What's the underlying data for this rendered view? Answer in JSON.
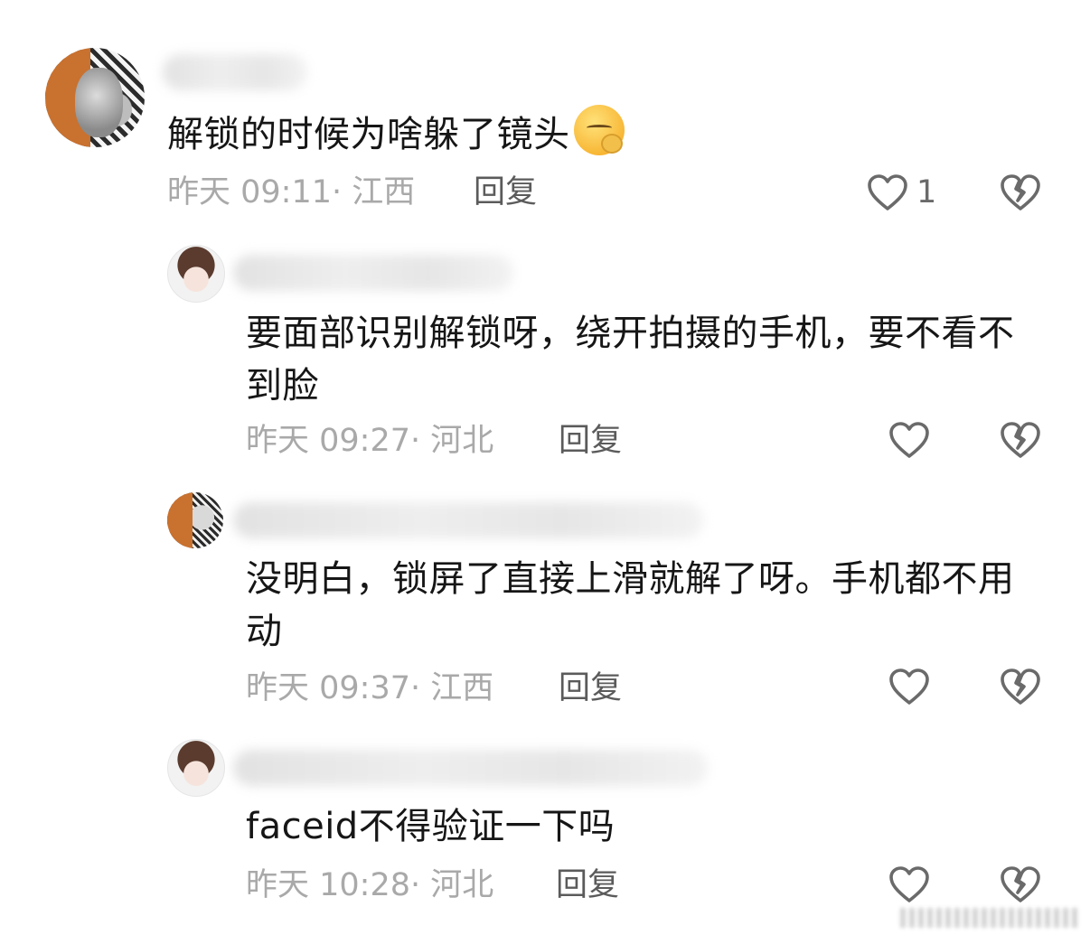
{
  "comments": [
    {
      "text": "解锁的时候为啥躲了镜头",
      "emoji": "shushing-face",
      "time_location": "昨天 09:11· 江西",
      "reply_label": "回复",
      "likes": "1"
    },
    {
      "text": "要面部识别解锁呀，绕开拍摄的手机，要不看不到脸",
      "time_location": "昨天 09:27· 河北",
      "reply_label": "回复"
    },
    {
      "text": "没明白，锁屏了直接上滑就解了呀。手机都不用动",
      "time_location": "昨天 09:37· 江西",
      "reply_label": "回复"
    },
    {
      "text": "faceid不得验证一下吗",
      "time_location": "昨天 10:28· 河北",
      "reply_label": "回复"
    }
  ],
  "icons": {
    "like": "heart-outline-icon",
    "dislike": "broken-heart-icon"
  },
  "colors": {
    "text": "#161616",
    "meta": "#a9a9a9",
    "reply": "#5b5b5b",
    "icon": "#6a6a6a"
  }
}
